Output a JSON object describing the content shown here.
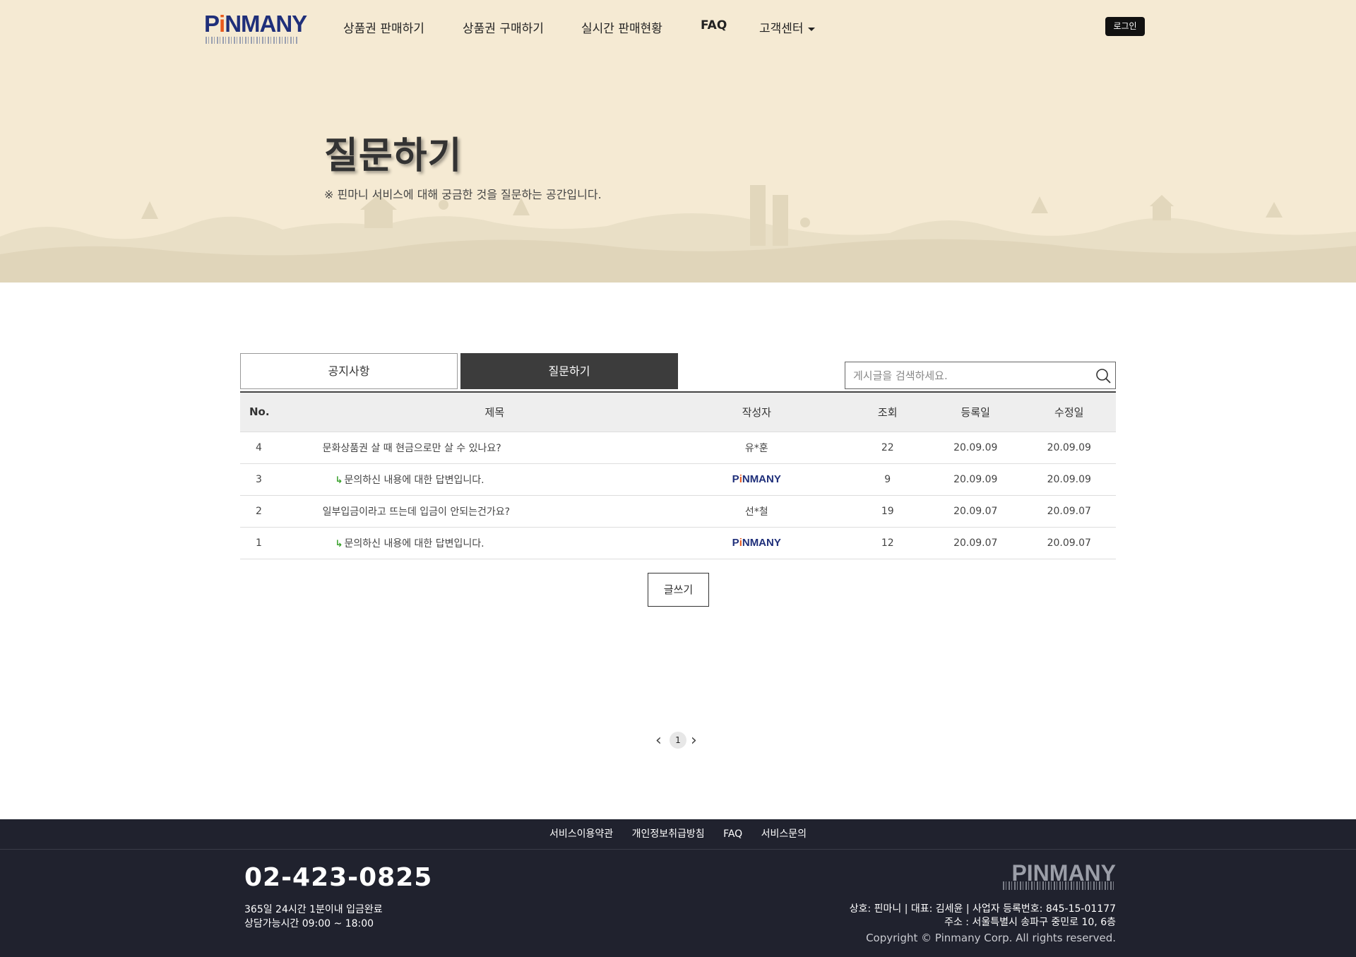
{
  "brand": {
    "logo_text": "PINMANY",
    "accent_color": "#e85a1c",
    "primary_color": "#1f2f7a"
  },
  "nav": {
    "items": [
      "상품권 판매하기",
      "상품권 구매하기",
      "실시간 판매현황",
      "FAQ",
      "고객센터"
    ],
    "login_label": "로그인"
  },
  "hero": {
    "title": "질문하기",
    "subtitle": "※ 핀마니 서비스에 대해 궁금한 것을 질문하는 공간입니다.",
    "background_color": "#f5ead3"
  },
  "tabs": {
    "notice": "공지사항",
    "qna": "질문하기",
    "active": "질문하기"
  },
  "search": {
    "placeholder": "게시글을 검색하세요.",
    "value": ""
  },
  "table": {
    "headers": {
      "no": "No.",
      "title": "제목",
      "author": "작성자",
      "views": "조회",
      "created": "등록일",
      "modified": "수정일"
    },
    "rows": [
      {
        "no": "4",
        "title": "문화상품권 살 때 현금으로만 살 수 있나요?",
        "author": "유*훈",
        "author_is_logo": false,
        "reply": false,
        "views": "22",
        "created": "20.09.09",
        "modified": "20.09.09"
      },
      {
        "no": "3",
        "title": "문의하신 내용에 대한 답변입니다.",
        "author": "PINMANY",
        "author_is_logo": true,
        "reply": true,
        "views": "9",
        "created": "20.09.09",
        "modified": "20.09.09"
      },
      {
        "no": "2",
        "title": "일부입금이라고 뜨는데 입금이 안되는건가요?",
        "author": "선*철",
        "author_is_logo": false,
        "reply": false,
        "views": "19",
        "created": "20.09.07",
        "modified": "20.09.07"
      },
      {
        "no": "1",
        "title": "문의하신 내용에 대한 답변입니다.",
        "author": "PINMANY",
        "author_is_logo": true,
        "reply": true,
        "views": "12",
        "created": "20.09.07",
        "modified": "20.09.07"
      }
    ]
  },
  "write_button": "글쓰기",
  "pagination": {
    "pages": [
      "1"
    ],
    "current": "1"
  },
  "footer": {
    "links": [
      "서비스이용약관",
      "개인정보취급방침",
      "FAQ",
      "서비스문의"
    ],
    "phone": "02-423-0825",
    "hours_line1": "365일 24시간 1분이내 입금완료",
    "hours_line2": "상담가능시간 09:00 ~ 18:00",
    "logo_text": "PINMANY",
    "business_line1": "상호: 핀마니 | 대표: 김세윤 | 사업자 등록번호: 845-15-01177",
    "business_line2": "주소 : 서울특별시 송파구 중민로 10, 6층",
    "copyright": "Copyright © Pinmany Corp. All rights reserved.",
    "background_color": "#20222e"
  }
}
